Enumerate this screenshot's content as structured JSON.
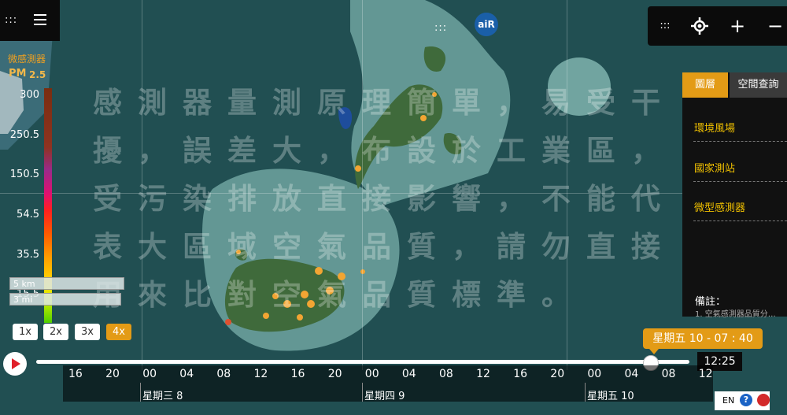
{
  "app": {
    "sensor_label": "微感測器",
    "pollutant": "PM",
    "pollutant_sub": "2.5",
    "logo_text": "aiR"
  },
  "watermark": {
    "lines": [
      "感測器量測原理簡單，易受干",
      "擾，誤差大，布設於工業區，",
      "受污染排放直接影響，不能代",
      "表大區域空氣品質，請勿直接",
      "用來比對空氣品質標準。"
    ]
  },
  "legend": {
    "ticks": [
      "300",
      "250.5",
      "150.5",
      "54.5",
      "35.5",
      "15.5"
    ],
    "colors": [
      "#7a2d10",
      "#9b2a8a",
      "#ff2020",
      "#ff9d00",
      "#ffd400",
      "#4fd000"
    ]
  },
  "scale": {
    "km_label": "5 km",
    "mi_label": "3 mi"
  },
  "speed": {
    "options": [
      "1x",
      "2x",
      "3x",
      "4x"
    ],
    "selected": "4x"
  },
  "controls": {
    "icons": [
      "grip-icon",
      "locate-icon",
      "zoom-in-icon",
      "zoom-out-icon"
    ],
    "zoom_in": "+",
    "zoom_out": "−"
  },
  "panel": {
    "tabs": [
      "圖層",
      "空間查詢"
    ],
    "active_tab": "圖層",
    "items": [
      "環境風場",
      "國家測站",
      "微型感測器"
    ],
    "note_title": "備註：",
    "note_text": "1. 空氣感測器品質分…"
  },
  "timeline": {
    "tooltip": "星期五 10 - 07 : 40",
    "clock": "12:25",
    "hours": [
      "16",
      "20",
      "00",
      "04",
      "08",
      "12",
      "16",
      "20",
      "00",
      "04",
      "08",
      "12",
      "16",
      "20",
      "00",
      "04",
      "08",
      "12"
    ],
    "days": [
      "星期三 8",
      "星期四 9",
      "星期五 10"
    ],
    "progress": 0.94
  },
  "language": {
    "code": "EN",
    "help": "?"
  }
}
